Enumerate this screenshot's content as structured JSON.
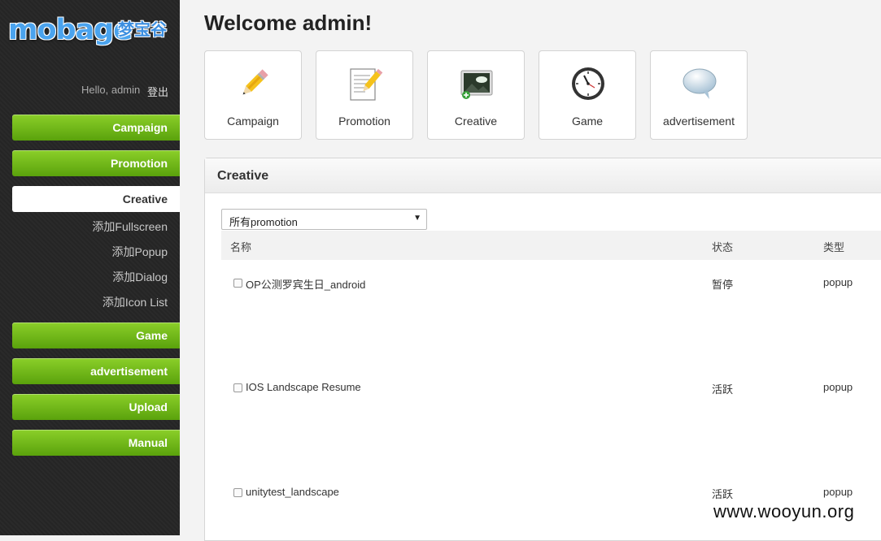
{
  "brand": {
    "logo_text": "mobage",
    "logo_cn": "梦宝谷"
  },
  "user": {
    "greeting": "Hello, admin",
    "logout_label": "登出"
  },
  "sidebar": {
    "items": [
      {
        "label": "Campaign"
      },
      {
        "label": "Promotion"
      },
      {
        "label": "Creative",
        "active": true
      },
      {
        "label": "Game"
      },
      {
        "label": "advertisement"
      },
      {
        "label": "Upload"
      },
      {
        "label": "Manual"
      }
    ],
    "creative_subitems": [
      {
        "label": "添加Fullscreen"
      },
      {
        "label": "添加Popup"
      },
      {
        "label": "添加Dialog"
      },
      {
        "label": "添加Icon List"
      }
    ]
  },
  "main": {
    "title": "Welcome admin!",
    "tiles": [
      {
        "label": "Campaign",
        "icon": "pencil-icon"
      },
      {
        "label": "Promotion",
        "icon": "document-pencil-icon"
      },
      {
        "label": "Creative",
        "icon": "image-add-icon"
      },
      {
        "label": "Game",
        "icon": "clock-icon"
      },
      {
        "label": "advertisement",
        "icon": "speech-bubble-icon"
      }
    ],
    "panel": {
      "title": "Creative",
      "filter": {
        "selected": "所有promotion"
      },
      "columns": [
        "名称",
        "状态",
        "类型"
      ],
      "rows": [
        {
          "name": "OP公测罗宾生日_android",
          "status": "暂停",
          "type": "popup"
        },
        {
          "name": "IOS Landscape Resume",
          "status": "活跃",
          "type": "popup"
        },
        {
          "name": "unitytest_landscape",
          "status": "活跃",
          "type": "popup"
        }
      ]
    }
  },
  "watermark": "www.wooyun.org",
  "colors": {
    "accent_green": "#6cb81a",
    "sidebar_bg": "#282828",
    "logo_blue": "#4aa3ee"
  }
}
